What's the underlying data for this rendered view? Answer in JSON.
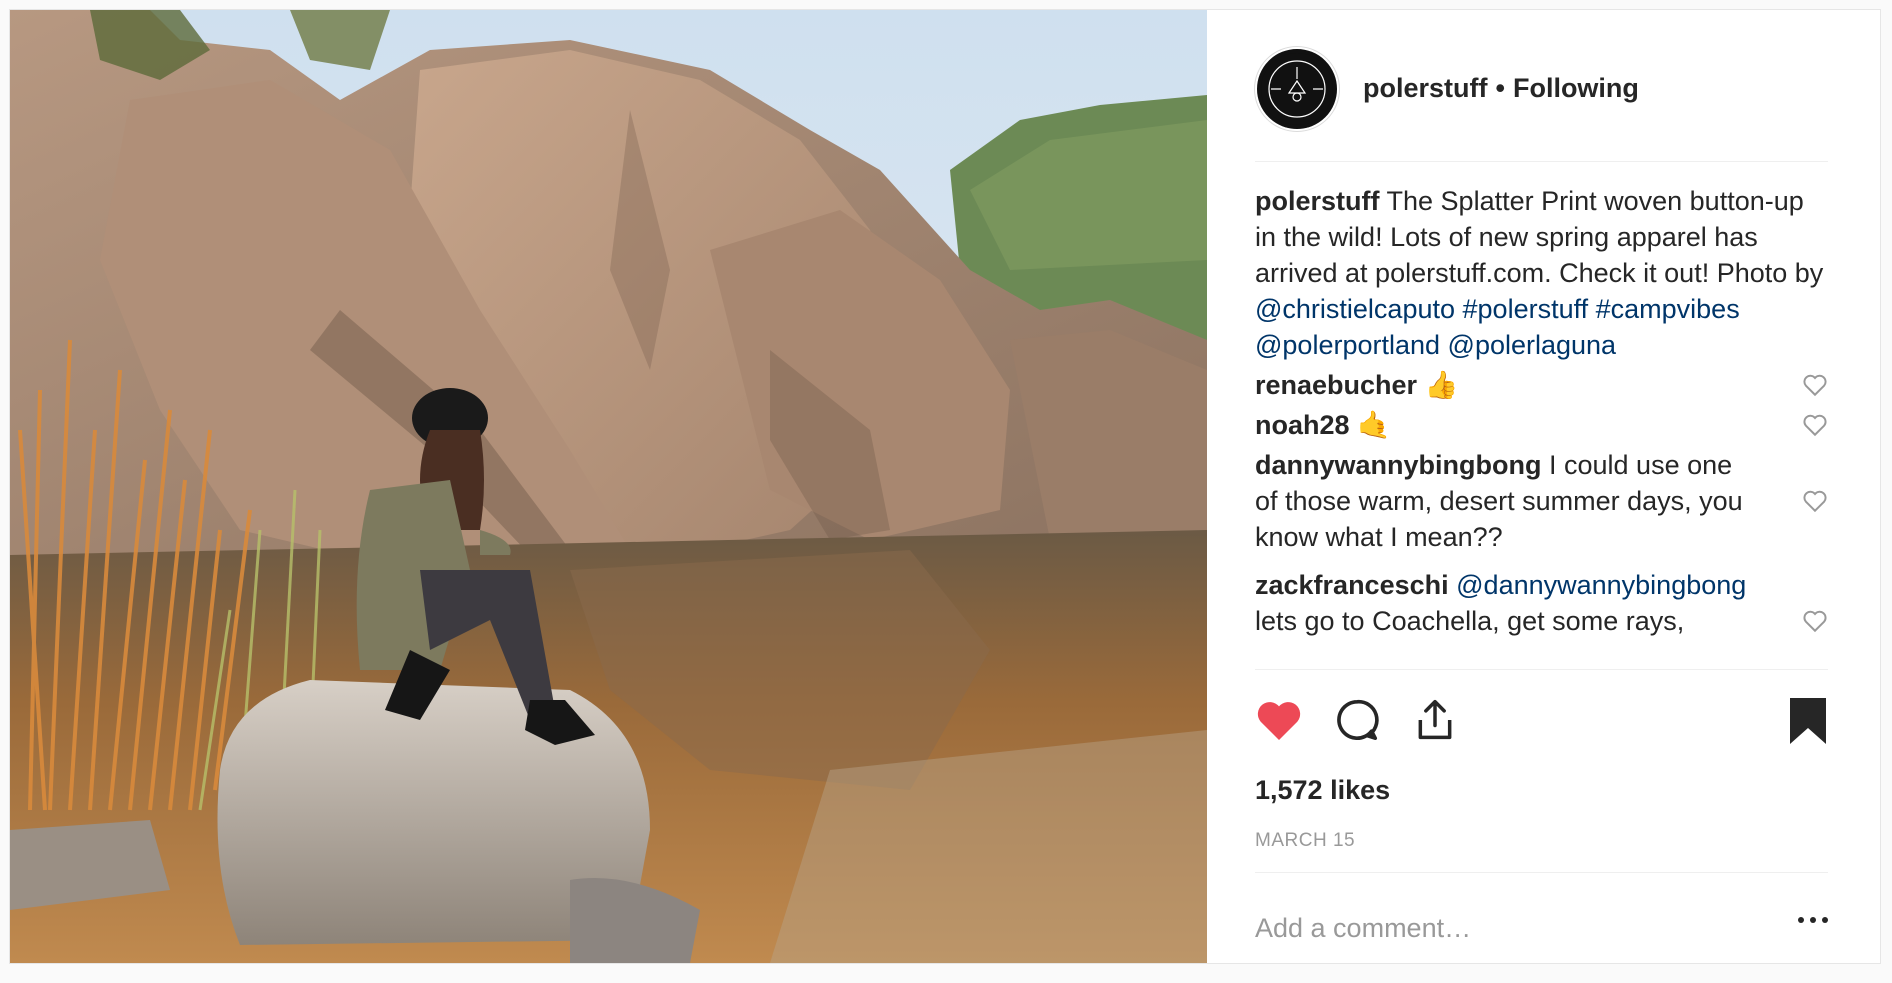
{
  "colors": {
    "heart_liked": "#ed4956",
    "link": "#003569",
    "text": "#262626",
    "muted": "#999999"
  },
  "post": {
    "author": "polerstuff",
    "separator": "•",
    "follow_status": "Following",
    "caption": {
      "user": "polerstuff",
      "text": "The Splatter Print woven button-up in the wild! Lots of new spring apparel has arrived at polerstuff.com. Check it out! Photo by",
      "tags": [
        "@christielcaputo",
        "#polerstuff",
        "#campvibes",
        "@polerportland",
        "@polerlaguna"
      ]
    },
    "comments": [
      {
        "user": "renaebucher",
        "text": "👍"
      },
      {
        "user": "noah28",
        "text": "🤙"
      },
      {
        "user": "dannywannybingbong",
        "text": "I could use one of those warm, desert summer days, you know what I mean??"
      },
      {
        "user": "zackfranceschi",
        "mention": "@dannywannybingbong",
        "text": "lets go to Coachella, get some rays,"
      }
    ],
    "likes": "1,572 likes",
    "date": "MARCH 15",
    "add_comment_placeholder": "Add a comment…",
    "icons": {
      "like": "heart-filled-icon",
      "comment": "comment-bubble-icon",
      "share": "share-upload-icon",
      "save": "bookmark-filled-icon",
      "comment_like": "heart-outline-icon",
      "more": "ellipsis-icon"
    }
  }
}
